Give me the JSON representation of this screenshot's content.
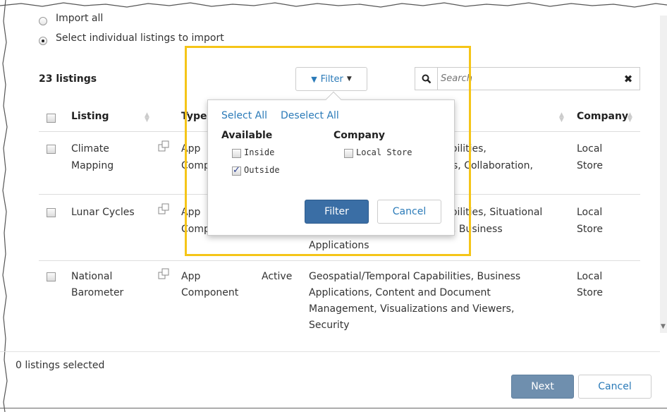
{
  "import_options": {
    "import_all": "Import all",
    "select_individual": "Select individual listings to import"
  },
  "listings_count": "23 listings",
  "filter_button": {
    "label": "Filter",
    "icon": "filter-icon"
  },
  "search": {
    "placeholder": "Search"
  },
  "columns": [
    "Listing",
    "Type",
    "Company"
  ],
  "rows": [
    {
      "listing": [
        "Climate",
        "Mapping"
      ],
      "type": [
        "App",
        "Comp"
      ],
      "categories": [
        "abilities,",
        "s, Collaboration,"
      ],
      "company": [
        "Local",
        "Store"
      ]
    },
    {
      "listing": [
        "Lunar Cycles"
      ],
      "type": [
        "App",
        "Comp"
      ],
      "categories": [
        "abilities, Situational",
        ", Business",
        "Applications"
      ],
      "company": [
        "Local",
        "Store"
      ]
    },
    {
      "listing": [
        "National",
        "Barometer"
      ],
      "type": [
        "App",
        "Component"
      ],
      "status": "Active",
      "categories": [
        "Geospatial/Temporal Capabilities, Business",
        "Applications, Content and Document",
        "Management, Visualizations and Viewers,",
        "Security"
      ],
      "company": [
        "Local",
        "Store"
      ]
    }
  ],
  "filter_popup": {
    "select_all": "Select All",
    "deselect_all": "Deselect All",
    "available_heading": "Available",
    "company_heading": "Company",
    "available_options": [
      {
        "label": "Inside",
        "checked": false
      },
      {
        "label": "Outside",
        "checked": true
      }
    ],
    "company_options": [
      {
        "label": "Local Store",
        "checked": false
      }
    ],
    "apply_label": "Filter",
    "cancel_label": "Cancel"
  },
  "footer": {
    "selected_text": "0 listings selected",
    "next_label": "Next",
    "cancel_label": "Cancel"
  },
  "colors": {
    "highlight": "#f5c518",
    "primary": "#3a6ea5",
    "link": "#2a7ab8",
    "next_disabled": "#6f8fae"
  }
}
